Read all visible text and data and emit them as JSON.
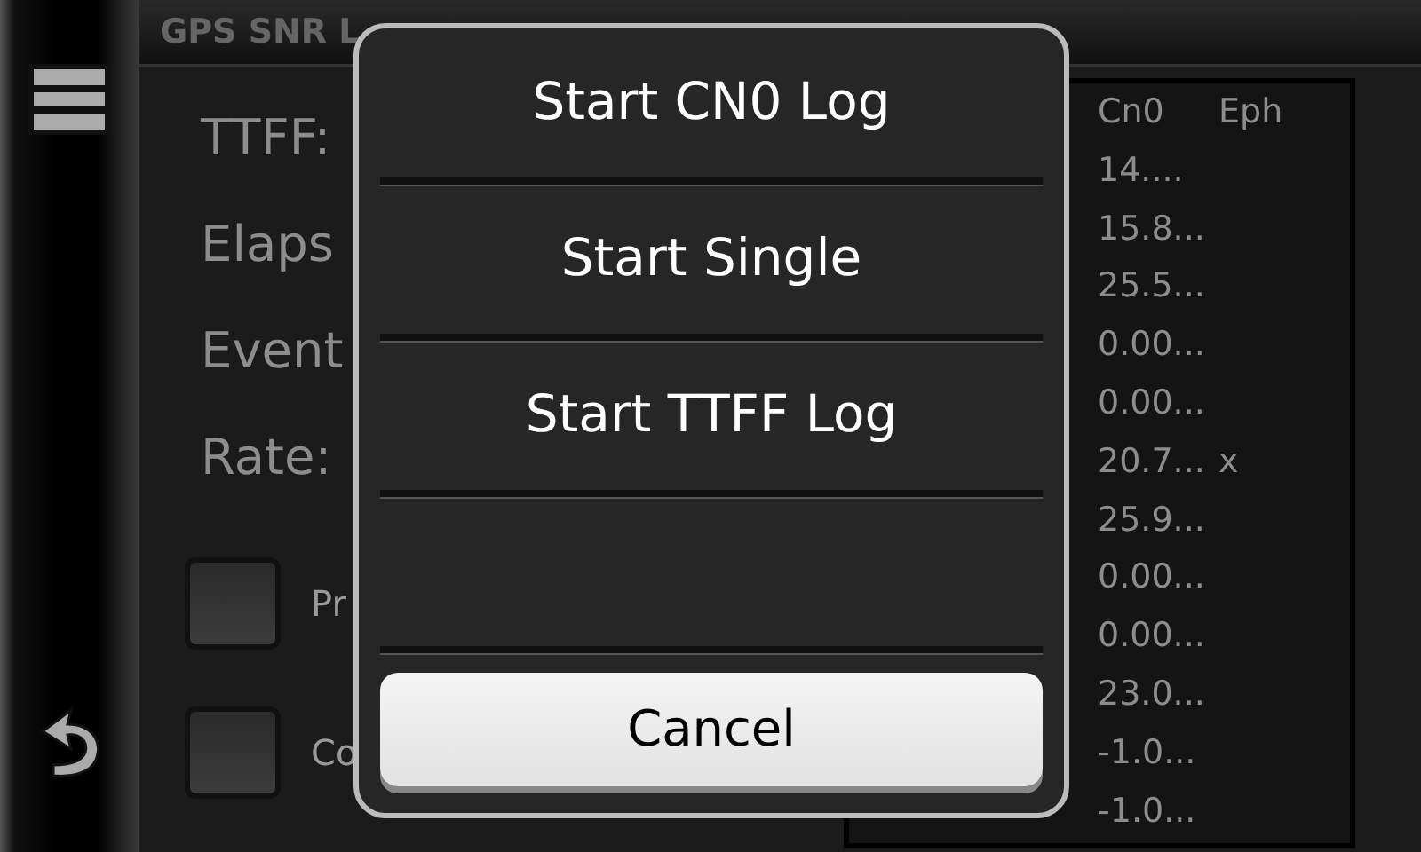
{
  "title_bar": {
    "title": "GPS SNR L"
  },
  "fields": [
    "TTFF:",
    "Elaps",
    "Event",
    "Rate:"
  ],
  "checkboxes": [
    {
      "label": "Pr",
      "checked": false
    },
    {
      "label": "Co",
      "checked": false
    }
  ],
  "table": {
    "columns": [
      "Cn0",
      "Eph"
    ],
    "rows": [
      {
        "cn0": "14...."
      },
      {
        "cn0": "15.8..."
      },
      {
        "cn0": "25.5..."
      },
      {
        "cn0": "0.00..."
      },
      {
        "cn0": "0.00..."
      },
      {
        "cn0": "20.7...",
        "eph": "x"
      },
      {
        "cn0": "25.9..."
      },
      {
        "cn0": "0.00..."
      },
      {
        "cn0": "0.00..."
      },
      {
        "cn0": "23.0..."
      },
      {
        "cn0": "-1.0..."
      },
      {
        "cn0": "-1.0..."
      }
    ]
  },
  "dialog": {
    "items": [
      "Start CN0 Log",
      "Start Single",
      "Start TTFF Log"
    ],
    "cancel": "Cancel"
  }
}
